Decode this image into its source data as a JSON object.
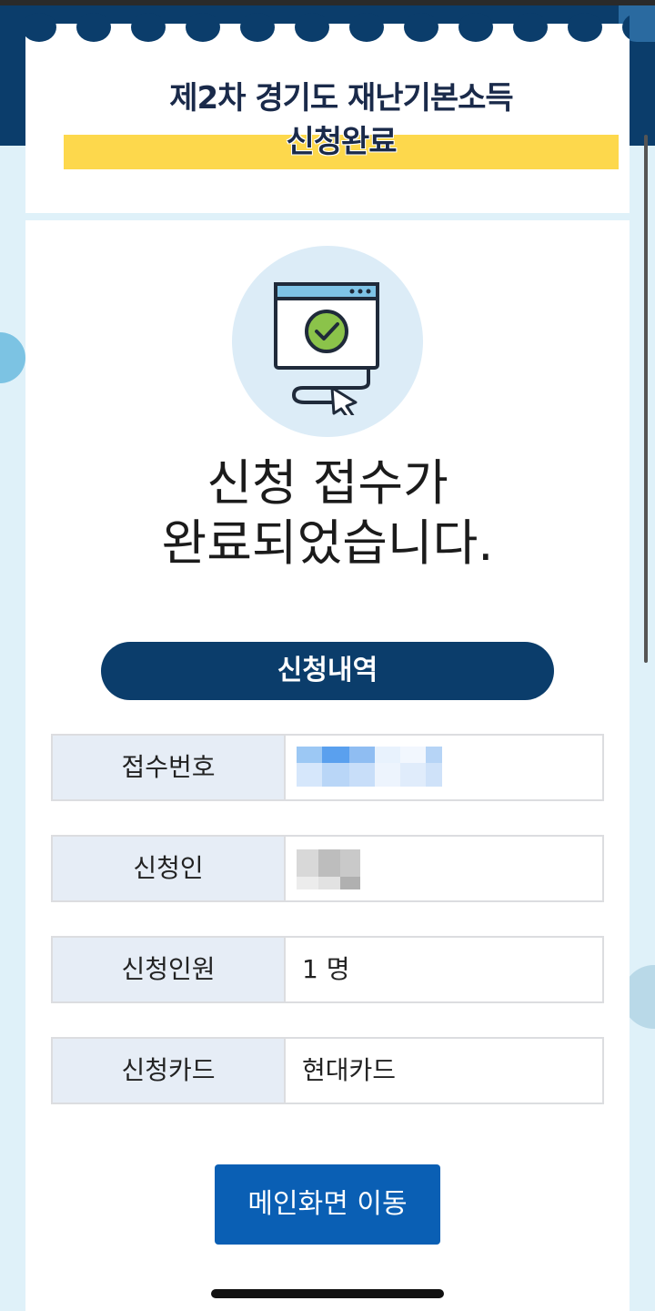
{
  "header": {
    "title_line1": "제2차 경기도 재난기본소득",
    "title_line2": "신청완료"
  },
  "completion": {
    "icon": "browser-check-cursor-icon",
    "message_line1": "신청 접수가",
    "message_line2": "완료되었습니다."
  },
  "details": {
    "heading": "신청내역",
    "rows": [
      {
        "label": "접수번호",
        "value": ""
      },
      {
        "label": "신청인",
        "value": ""
      },
      {
        "label": "신청인원",
        "value": "1 명"
      },
      {
        "label": "신청카드",
        "value": "현대카드"
      }
    ]
  },
  "actions": {
    "main_button_label": "메인화면 이동"
  },
  "colors": {
    "navy": "#0b3d6b",
    "highlight_yellow": "#fdd84c",
    "button_blue": "#0a5fb4",
    "label_cell_bg": "#e6edf6",
    "page_bg": "#dff1f9"
  }
}
